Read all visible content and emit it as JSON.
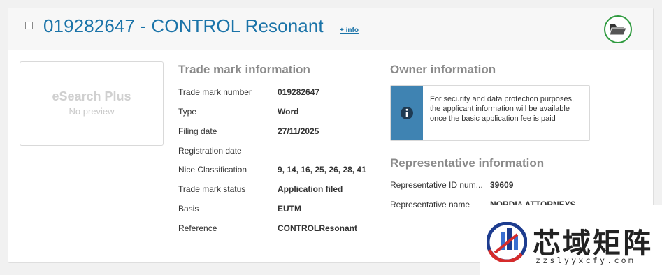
{
  "header": {
    "title": "019282647 - CONTROL Resonant",
    "info_link": "+ info",
    "folder_icon": "open-folder-icon"
  },
  "preview": {
    "title": "eSearch Plus",
    "subtitle": "No preview"
  },
  "trademark": {
    "heading": "Trade mark information",
    "rows": [
      {
        "label": "Trade mark number",
        "value": "019282647"
      },
      {
        "label": "Type",
        "value": "Word"
      },
      {
        "label": "Filing date",
        "value": "27/11/2025"
      },
      {
        "label": "Registration date",
        "value": ""
      },
      {
        "label": "Nice Classification",
        "value": "9, 14, 16, 25, 26, 28, 41"
      },
      {
        "label": "Trade mark status",
        "value": "Application filed"
      },
      {
        "label": "Basis",
        "value": "EUTM"
      },
      {
        "label": "Reference",
        "value": "CONTROLResonant"
      }
    ]
  },
  "owner": {
    "heading": "Owner information",
    "notice_icon": "info-icon",
    "notice_text": "For security and data protection purposes, the applicant information will be available once the basic application fee is paid"
  },
  "representative": {
    "heading": "Representative information",
    "rows": [
      {
        "label": "Representative ID num...",
        "value": "39609"
      },
      {
        "label": "Representative name",
        "value": "NORDIA ATTORNEYS"
      }
    ]
  },
  "watermark": {
    "text_cn": "芯域矩阵",
    "text_en": "zzslyyxcfy.com"
  },
  "colors": {
    "title_blue": "#1a73a8",
    "folder_ring_green": "#2e9a3e",
    "notice_blue": "#3f83b2"
  }
}
